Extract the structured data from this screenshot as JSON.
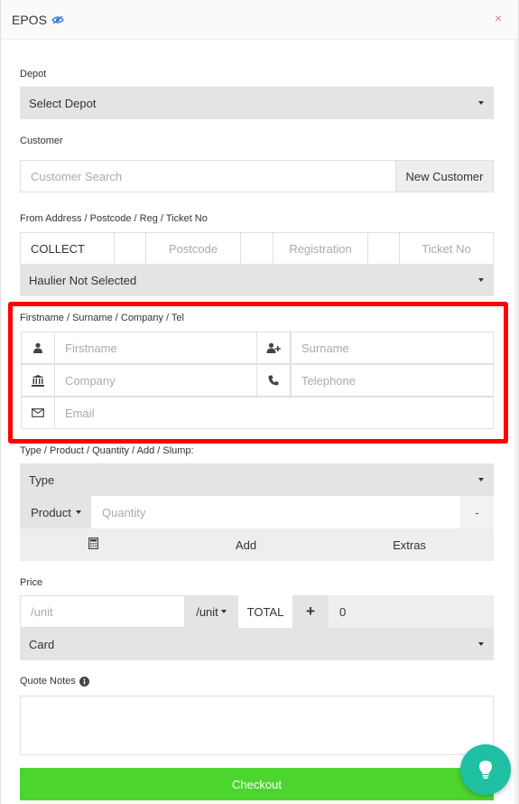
{
  "header": {
    "title": "EPOS",
    "close": "×"
  },
  "depot": {
    "label": "Depot",
    "value": "Select Depot"
  },
  "customer": {
    "label": "Customer",
    "search_placeholder": "Customer Search",
    "new_customer": "New Customer"
  },
  "address": {
    "label": "From Address / Postcode / Reg / Ticket No",
    "collect": "COLLECT",
    "postcode_placeholder": "Postcode",
    "registration_placeholder": "Registration",
    "ticket_placeholder": "Ticket No",
    "haulier": "Haulier Not Selected"
  },
  "contact": {
    "label": "Firstname / Surname / Company / Tel",
    "firstname_placeholder": "Firstname",
    "surname_placeholder": "Surname",
    "company_placeholder": "Company",
    "telephone_placeholder": "Telephone",
    "email_placeholder": "Email"
  },
  "product": {
    "label": "Type / Product / Quantity / Add / Slump:",
    "type": "Type",
    "product_button": "Product",
    "quantity_placeholder": "Quantity",
    "slump": "-",
    "add": "Add",
    "extras": "Extras"
  },
  "price": {
    "label": "Price",
    "unit_placeholder": "/unit",
    "unit_dropdown": "/unit",
    "total_label": "TOTAL",
    "plus": "+",
    "total_value": "0",
    "payment": "Card"
  },
  "notes": {
    "label": "Quote Notes"
  },
  "checkout": {
    "label": "Checkout"
  },
  "colors": {
    "checkout": "#4cd42f",
    "fab": "#1fbfa4",
    "highlight": "#ff0000",
    "eye_icon": "#3a7bd5"
  }
}
